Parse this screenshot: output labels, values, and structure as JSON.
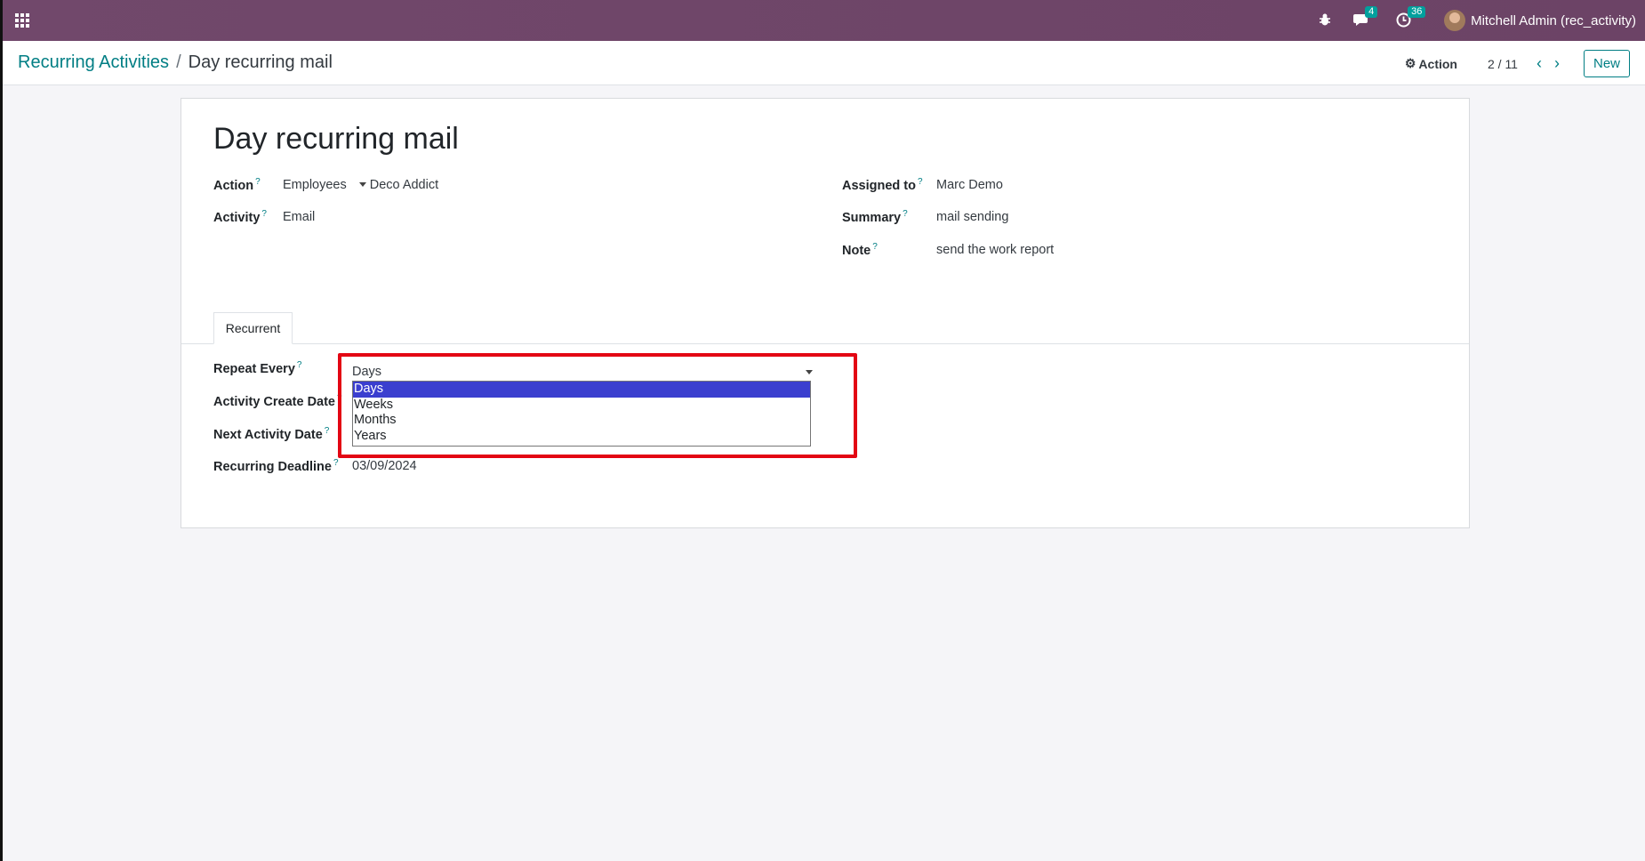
{
  "navbar": {
    "apps_icon": "apps-grid-icon",
    "messages_count": "4",
    "activities_count": "36",
    "user_name": "Mitchell Admin (rec_activity)"
  },
  "breadcrumb": {
    "parent": "Recurring Activities",
    "separator": "/",
    "current": "Day recurring mail"
  },
  "control_panel": {
    "action_label": "Action",
    "pager": "2 / 11",
    "new_label": "New"
  },
  "form": {
    "title": "Day recurring mail",
    "action_label": "Action",
    "action_model": "Employees",
    "action_record": "Deco Addict",
    "activity_label": "Activity",
    "activity_value": "Email",
    "assigned_label": "Assigned to",
    "assigned_value": "Marc Demo",
    "summary_label": "Summary",
    "summary_value": "mail sending",
    "note_label": "Note",
    "note_value": "send the work report",
    "help_mark": "?"
  },
  "tabs": [
    {
      "label": "Recurrent"
    }
  ],
  "recurrent": {
    "repeat_label": "Repeat Every",
    "repeat_value": "Days",
    "repeat_options": [
      "Days",
      "Weeks",
      "Months",
      "Years"
    ],
    "create_date_label": "Activity Create Date",
    "next_date_label": "Next Activity Date",
    "deadline_label": "Recurring Deadline",
    "deadline_value": "03/09/2024"
  },
  "colors": {
    "navbar": "#71486b",
    "link": "#017e84",
    "selected_option": "#3b3fcf",
    "highlight_box": "#e30613"
  }
}
